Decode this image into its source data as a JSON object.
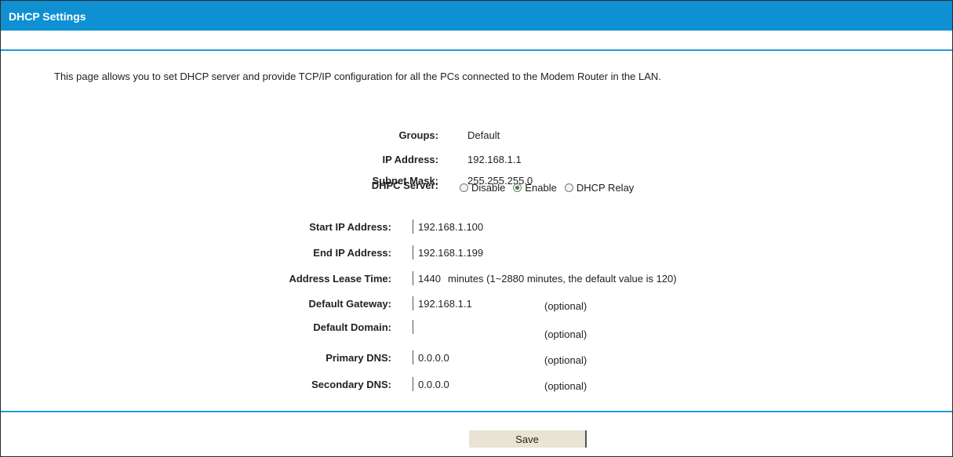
{
  "header": {
    "title": "DHCP Settings"
  },
  "description": "This page allows you to set DHCP server and provide TCP/IP configuration for all the PCs connected to the Modem Router in the LAN.",
  "summary": {
    "groups_label": "Groups:",
    "groups_value": "Default",
    "ip_label": "IP Address:",
    "ip_value": "192.168.1.1",
    "mask_label": "Subnet Mask:",
    "mask_value": "255.255.255.0",
    "server_label": "DHPC Server:",
    "server_options": [
      "Disable",
      "Enable",
      "DHCP Relay"
    ],
    "server_selected": "Enable"
  },
  "form": {
    "start_ip_label": "Start IP Address:",
    "start_ip_value": "192.168.1.100",
    "end_ip_label": "End IP Address:",
    "end_ip_value": "192.168.1.199",
    "lease_label": "Address Lease Time:",
    "lease_value": "1440",
    "lease_hint": "minutes (1~2880 minutes, the default value is 120)",
    "gateway_label": "Default Gateway:",
    "gateway_value": "192.168.1.1",
    "domain_label": "Default Domain:",
    "domain_value": "",
    "primary_dns_label": "Primary DNS:",
    "primary_dns_value": "0.0.0.0",
    "secondary_dns_label": "Secondary DNS:",
    "secondary_dns_value": "0.0.0.0",
    "optional_hint": "(optional)"
  },
  "actions": {
    "save_label": "Save"
  }
}
